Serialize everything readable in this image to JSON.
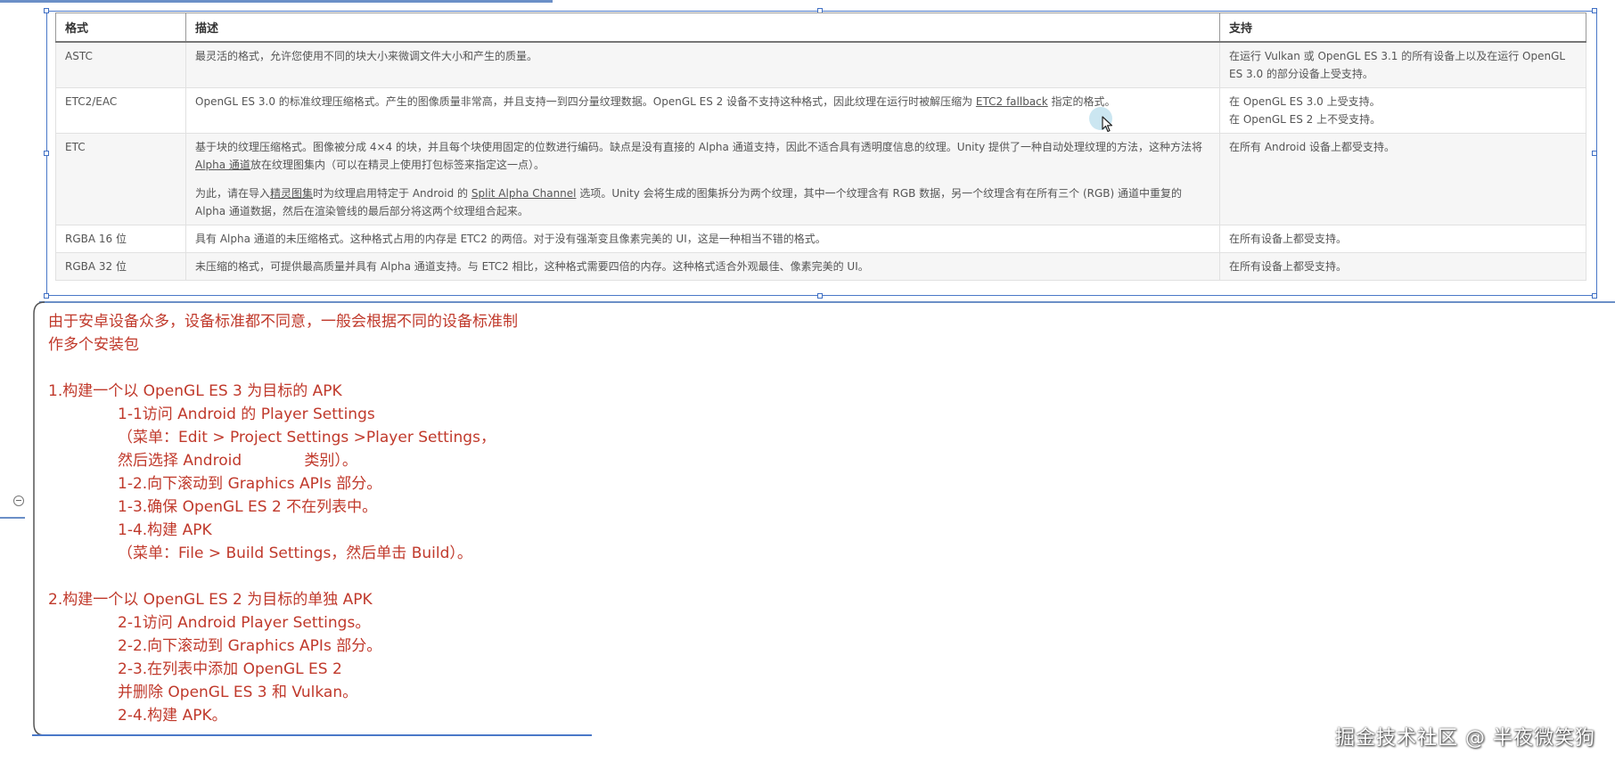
{
  "table": {
    "headers": {
      "format": "格式",
      "description": "描述",
      "support": "支持"
    },
    "rows": [
      {
        "format": "ASTC",
        "description": "最灵活的格式，允许您使用不同的块大小来微调文件大小和产生的质量。",
        "support": "在运行 Vulkan 或 OpenGL ES 3.1 的所有设备上以及在运行 OpenGL ES 3.0 的部分设备上受支持。"
      },
      {
        "format": "ETC2/EAC",
        "description_a": "OpenGL ES 3.0 的标准纹理压缩格式。产生的图像质量非常高，并且支持一到四分量纹理数据。OpenGL ES 2 设备不支持这种格式，因此纹理在运行时被解压缩为 ",
        "description_link": "ETC2 fallback",
        "description_b": " 指定的格式。",
        "support_1": "在 OpenGL ES 3.0 上受支持。",
        "support_2": "在 OpenGL ES 2 上不受支持。"
      },
      {
        "format": "ETC",
        "p1_a": "基于块的纹理压缩格式。图像被分成 4×4 的块，并且每个块使用固定的位数进行编码。缺点是没有直接的 Alpha 通道支持，因此不适合具有透明度信息的纹理。Unity 提供了一种自动处理纹理的方法，这种方法将 ",
        "p1_link": "Alpha 通道",
        "p1_b": "放在纹理图集内（可以在精灵上使用打包标签来指定这一点）。",
        "p2_a": "为此，请在导入",
        "p2_link1": "精灵图集",
        "p2_b": "时为纹理启用特定于 Android 的 ",
        "p2_link2": "Split Alpha Channel",
        "p2_c": " 选项。Unity 会将生成的图集拆分为两个纹理，其中一个纹理含有 RGB 数据，另一个纹理含有在所有三个 (RGB) 通道中重复的 Alpha 通道数据，然后在渲染管线的最后部分将这两个纹理组合起来。",
        "support": "在所有 Android 设备上都受支持。"
      },
      {
        "format": "RGBA 16 位",
        "description": "具有 Alpha 通道的未压缩格式。这种格式占用的内存是 ETC2 的两倍。对于没有强渐变且像素完美的 UI，这是一种相当不错的格式。",
        "support": "在所有设备上都受支持。"
      },
      {
        "format": "RGBA 32 位",
        "description": "未压缩的格式，可提供最高质量并具有 Alpha 通道支持。与 ETC2 相比，这种格式需要四倍的内存。这种格式适合外观最佳、像素完美的 UI。",
        "support": "在所有设备上都受支持。"
      }
    ]
  },
  "notes": {
    "intro_1": "由于安卓设备众多，设备标准都不同意，一般会根据不同的设备标准制",
    "intro_2": "作多个安装包",
    "s1_title": "1.构建一个以 OpenGL ES 3 为目标的 APK",
    "s1_1": "1-1访问 Android 的 Player Settings",
    "s1_1_menu": "（菜单：Edit > Project Settings >Player Settings，",
    "s1_1_menu2": "然后选择 Android             类别）。",
    "s1_2": "1-2.向下滚动到 Graphics APIs 部分。",
    "s1_3": "1-3.确保 OpenGL ES 2 不在列表中。",
    "s1_4": "1-4.构建 APK",
    "s1_4_menu": "（菜单：File > Build Settings，然后单击 Build）。",
    "s2_title": "2.构建一个以 OpenGL ES 2 为目标的单独 APK",
    "s2_1": "2-1访问 Android Player Settings。",
    "s2_2": "2-2.向下滚动到 Graphics APIs 部分。",
    "s2_3": "2-3.在列表中添加 OpenGL ES 2",
    "s2_3b": "并删除 OpenGL ES 3 和 Vulkan。",
    "s2_4": "2-4.构建 APK。"
  },
  "watermark": "掘金技术社区 @ 半夜微笑狗",
  "colors": {
    "note_text": "#c0392b",
    "selection_blue": "#4a78c8"
  },
  "icons": [
    "cursor-icon",
    "collapse-toggle-icon"
  ]
}
